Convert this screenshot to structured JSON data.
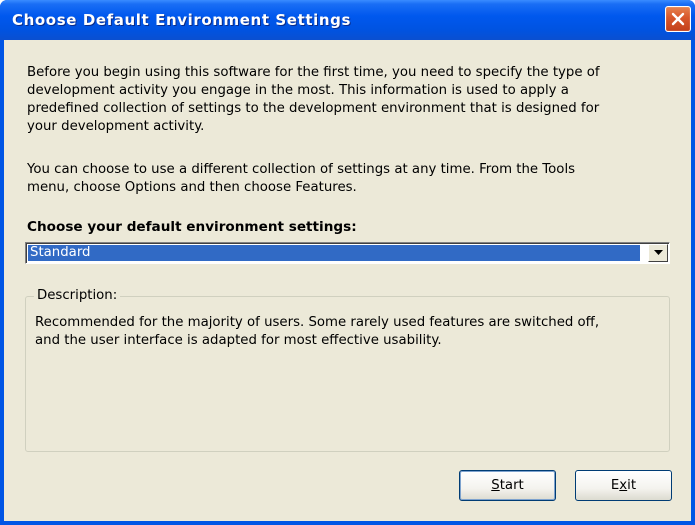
{
  "window": {
    "title": "Choose Default Environment Settings"
  },
  "titlebar": {
    "close_icon": "close-icon"
  },
  "intro": {
    "paragraph1": "Before you begin using this software for the first time, you need to specify the type of\ndevelopment activity you engage in the most. This information is used to apply a\npredefined collection of settings to the development environment that is designed for\nyour development activity.",
    "paragraph2": "You can choose to use a different collection of settings at any time. From the Tools\nmenu, choose Options and then choose Features."
  },
  "settings": {
    "label": "Choose your default environment settings:",
    "selected": "Standard",
    "dropdown_icon": "chevron-down-icon"
  },
  "description": {
    "legend": "Description:",
    "text": "Recommended for the majority of users. Some rarely used features are switched off,\nand the user interface is adapted for most effective usability."
  },
  "buttons": {
    "start_prefix": "",
    "start_mnemonic": "S",
    "start_rest": "tart",
    "exit_prefix": "E",
    "exit_mnemonic": "x",
    "exit_rest": "it"
  },
  "colors": {
    "titlebar": "#0058ee",
    "dialog_bg": "#ece9d8",
    "selection": "#316ac5",
    "close": "#d8572b"
  }
}
